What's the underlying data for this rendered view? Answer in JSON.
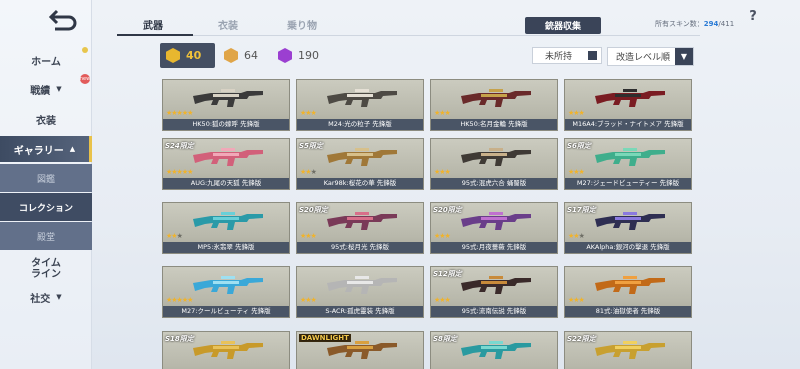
{
  "sidebar": {
    "items": [
      {
        "label": "ホーム"
      },
      {
        "label": "戦績"
      },
      {
        "label": "衣装"
      },
      {
        "label": "ギャラリー"
      },
      {
        "label": "タイム\nライン"
      },
      {
        "label": "社交"
      }
    ],
    "gallery_sub": [
      {
        "label": "図鑑"
      },
      {
        "label": "コレクション"
      },
      {
        "label": "殿堂"
      }
    ],
    "new_badge": "new"
  },
  "tabs": [
    {
      "label": "武器"
    },
    {
      "label": "衣装"
    },
    {
      "label": "乗り物"
    }
  ],
  "collect_button": "銃器収集",
  "skin_count": {
    "label": "所有スキン数：",
    "owned": "294",
    "total": "/411"
  },
  "help": "?",
  "currencies": [
    {
      "value": "40",
      "color": "#e8b72f"
    },
    {
      "value": "64",
      "color": "#e0a548"
    },
    {
      "value": "190",
      "color": "#9b3fd1"
    }
  ],
  "filter": {
    "unowned_label": "未所持",
    "sort_label": "改造レベル順",
    "sort_caret": "▼"
  },
  "cards": [
    {
      "name": "HK50:狐の嫁呼 先鋒版",
      "tag": "",
      "stars": 5,
      "gun": "#3b3b3b",
      "accent": "#d8d2c4"
    },
    {
      "name": "M24:光の粒子 先鋒版",
      "tag": "",
      "stars": 3,
      "gun": "#4d4a44",
      "accent": "#e5e0d5"
    },
    {
      "name": "HK50:名月金輪 先鋒版",
      "tag": "",
      "stars": 3,
      "gun": "#6a2a2a",
      "accent": "#c6a24a"
    },
    {
      "name": "M16A4:ブラッド・ナイトメア 先鋒版",
      "tag": "",
      "stars": 3,
      "gun": "#7a1c22",
      "accent": "#2e2e2e"
    },
    {
      "name": "AUG:九尾の天狐 先鋒版",
      "tag": "S24限定",
      "stars": 5,
      "gun": "#d2607a",
      "accent": "#f1a8b8"
    },
    {
      "name": "Kar98k:桜花の華 先鋒版",
      "tag": "S5限定",
      "stars": 2,
      "gun": "#a07838",
      "accent": "#d7c08a"
    },
    {
      "name": "95式:混虎六合 蛹蜀版",
      "tag": "",
      "stars": 3,
      "gun": "#3f3a35",
      "accent": "#c8b08a"
    },
    {
      "name": "M27:ジェードビューティー 先鋒版",
      "tag": "S6限定",
      "stars": 3,
      "gun": "#3fae8c",
      "accent": "#7ad8b8"
    },
    {
      "name": "MP5:氷翡翠 先鋒版",
      "tag": "",
      "stars": 2,
      "gun": "#2a9aa8",
      "accent": "#69d0d8"
    },
    {
      "name": "95式:桜月光 先鋒版",
      "tag": "S20限定",
      "stars": 3,
      "gun": "#7a3a58",
      "accent": "#d86f8a"
    },
    {
      "name": "95式:月夜薔薇 先鋒版",
      "tag": "S20限定",
      "stars": 3,
      "gun": "#6a3e8a",
      "accent": "#c070d0"
    },
    {
      "name": "AKAlpha:銀河の撃退 先鋒版",
      "tag": "S17限定",
      "stars": 2,
      "gun": "#2e2e52",
      "accent": "#8a7ae0"
    },
    {
      "name": "M27:クールビューティ 先鋒版",
      "tag": "",
      "stars": 5,
      "gun": "#3aa8d8",
      "accent": "#9ee0f2"
    },
    {
      "name": "S-ACR:孤虎靈装 先鋒版",
      "tag": "",
      "stars": 3,
      "gun": "#b5b5b5",
      "accent": "#e8e8e8"
    },
    {
      "name": "95式:流南伝説 先鋒版",
      "tag": "S12限定",
      "stars": 3,
      "gun": "#3a2a2a",
      "accent": "#c88a3a"
    },
    {
      "name": "81式:油獄使者 先鋒版",
      "tag": "",
      "stars": 3,
      "gun": "#c26a18",
      "accent": "#f0a040"
    },
    {
      "name": "",
      "tag": "S18限定",
      "stars": 0,
      "gun": "#c89a2a",
      "accent": "#e8c25a"
    },
    {
      "name": "",
      "tag": "DAWNLIGHT",
      "stars": 0,
      "gun": "#8a5a2a",
      "accent": "#d8a040"
    },
    {
      "name": "",
      "tag": "S8限定",
      "stars": 0,
      "gun": "#2a9aa0",
      "accent": "#7ad8d0"
    },
    {
      "name": "",
      "tag": "S22限定",
      "stars": 0,
      "gun": "#c8a030",
      "accent": "#f0d060"
    }
  ]
}
